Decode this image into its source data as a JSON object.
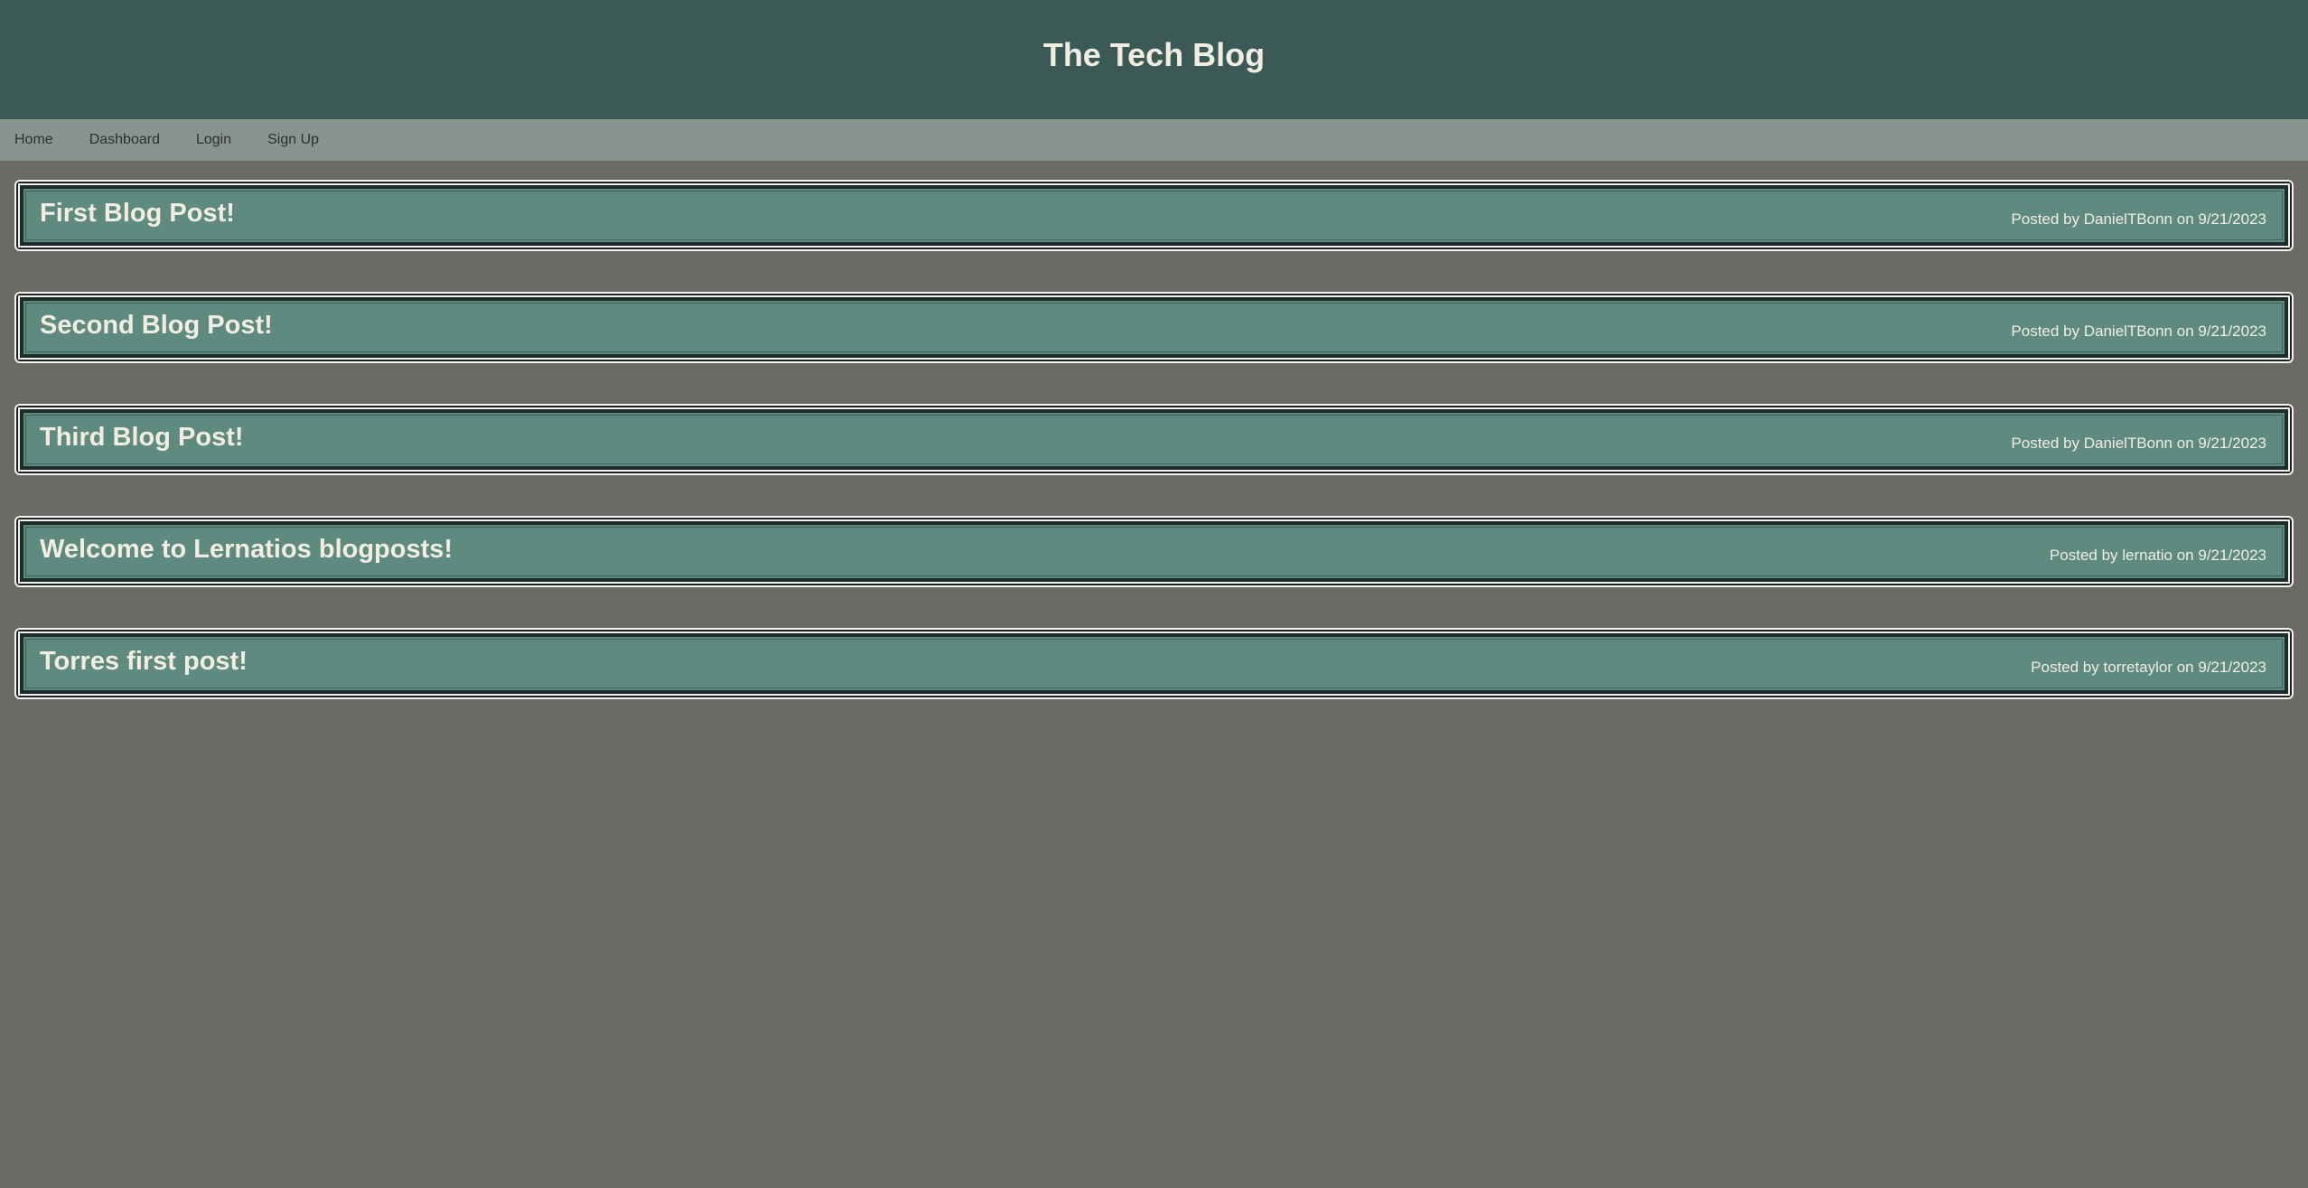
{
  "header": {
    "title": "The Tech Blog"
  },
  "nav": {
    "items": [
      {
        "label": "Home"
      },
      {
        "label": "Dashboard"
      },
      {
        "label": "Login"
      },
      {
        "label": "Sign Up"
      }
    ]
  },
  "posts": [
    {
      "title": "First Blog Post!",
      "meta": "Posted by DanielTBonn on 9/21/2023"
    },
    {
      "title": "Second Blog Post!",
      "meta": "Posted by DanielTBonn on 9/21/2023"
    },
    {
      "title": "Third Blog Post!",
      "meta": "Posted by DanielTBonn on 9/21/2023"
    },
    {
      "title": "Welcome to Lernatios blogposts!",
      "meta": "Posted by lernatio on 9/21/2023"
    },
    {
      "title": "Torres first post!",
      "meta": "Posted by torretaylor on 9/21/2023"
    }
  ],
  "colors": {
    "header_bg": "#3c5a55",
    "nav_bg": "#88958e",
    "page_bg": "#6b6a65",
    "card_bg": "#5f8a80",
    "text_light": "#f1ede3"
  }
}
